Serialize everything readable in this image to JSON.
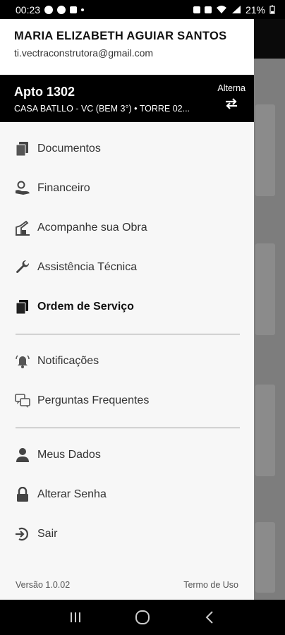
{
  "status_bar": {
    "time": "00:23",
    "battery": "21%"
  },
  "drawer": {
    "user_name": "MARIA ELIZABETH AGUIAR SANTOS",
    "user_email": "ti.vectraconstrutora@gmail.com",
    "unit_title": "Apto 1302",
    "unit_subtitle": "CASA BATLLO - VC (BEM 3°)  • TORRE 02...",
    "switch_label": "Alterna"
  },
  "menu": {
    "group1": [
      {
        "label": "Documentos",
        "icon": "documents-icon"
      },
      {
        "label": "Financeiro",
        "icon": "finance-icon"
      },
      {
        "label": "Acompanhe sua Obra",
        "icon": "construction-icon"
      },
      {
        "label": "Assistência Técnica",
        "icon": "wrench-icon"
      },
      {
        "label": "Ordem de Serviço",
        "icon": "service-order-icon",
        "active": true
      }
    ],
    "group2": [
      {
        "label": "Notificações",
        "icon": "bell-icon"
      },
      {
        "label": "Perguntas Frequentes",
        "icon": "faq-icon"
      }
    ],
    "group3": [
      {
        "label": "Meus Dados",
        "icon": "user-icon"
      },
      {
        "label": "Alterar Senha",
        "icon": "lock-icon"
      },
      {
        "label": "Sair",
        "icon": "logout-icon"
      }
    ]
  },
  "footer": {
    "version": "Versão 1.0.02",
    "terms": "Termo de Uso"
  },
  "colors": {
    "drawer_bg": "#f7f7f7",
    "header_bg": "#000000",
    "icon": "#444444"
  }
}
